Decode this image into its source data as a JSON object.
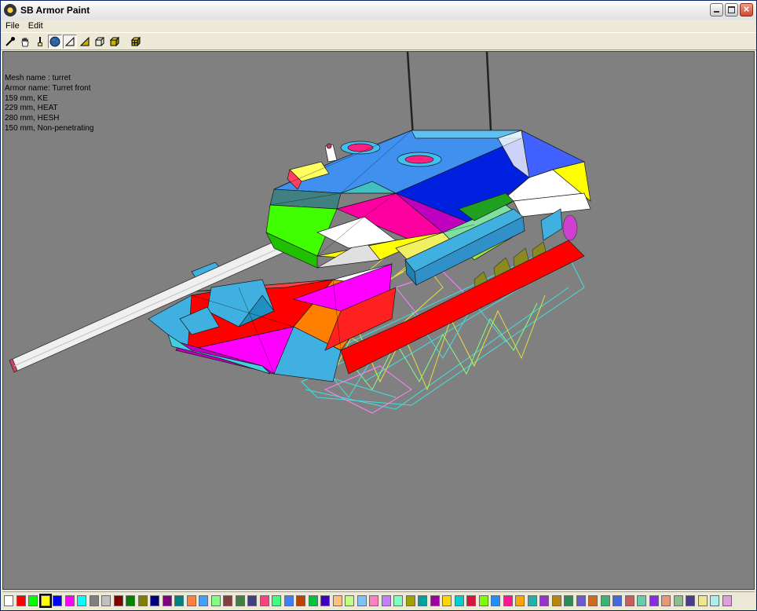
{
  "window": {
    "title": "SB Armor Paint"
  },
  "menu": {
    "items": [
      "File",
      "Edit"
    ]
  },
  "toolbar": {
    "tools": [
      {
        "icon": "eyedropper-icon"
      },
      {
        "icon": "hand-icon"
      },
      {
        "icon": "brush-icon"
      },
      {
        "icon": "globe-icon",
        "active": true
      },
      {
        "icon": "triangle-outline-icon",
        "active": true
      },
      {
        "icon": "triangle-filled-icon"
      },
      {
        "icon": "cube-outline-icon"
      },
      {
        "icon": "cube-filled-icon"
      },
      {
        "icon": "cube-grid-icon"
      }
    ]
  },
  "info": {
    "lines": [
      "Mesh name : turret",
      "Armor name: Turret front",
      "159 mm, KE",
      "229 mm, HEAT",
      "280 mm, HESH",
      "150 mm, Non-penetrating"
    ]
  },
  "colors": {
    "viewport_bg": "#808080",
    "window_chrome": "#ece9d8"
  },
  "palette": {
    "selected_index": 3,
    "swatches": [
      "#ffffff",
      "#ff0000",
      "#00ff00",
      "#ffff00",
      "#0000ff",
      "#ff00ff",
      "#00ffff",
      "#808080",
      "#c0c0c0",
      "#800000",
      "#008000",
      "#808000",
      "#000080",
      "#800080",
      "#008080",
      "#ff8040",
      "#40a0ff",
      "#80ff80",
      "#804040",
      "#408040",
      "#404080",
      "#ff4080",
      "#40ff80",
      "#4080ff",
      "#c04000",
      "#00c040",
      "#4000c0",
      "#ffc080",
      "#c0ff80",
      "#80c0ff",
      "#ff80c0",
      "#c080ff",
      "#80ffc0",
      "#a0a000",
      "#00a0a0",
      "#a000a0",
      "#ffd700",
      "#00ced1",
      "#dc143c",
      "#7fff00",
      "#1e90ff",
      "#ff1493",
      "#ffa500",
      "#20b2aa",
      "#9932cc",
      "#b8860b",
      "#2e8b57",
      "#6a5acd",
      "#d2691e",
      "#3cb371",
      "#4169e1",
      "#cd5c5c",
      "#66cdaa",
      "#8a2be2",
      "#e9967a",
      "#8fbc8f",
      "#483d8b",
      "#f0e68c",
      "#afeeee",
      "#dda0dd"
    ]
  }
}
